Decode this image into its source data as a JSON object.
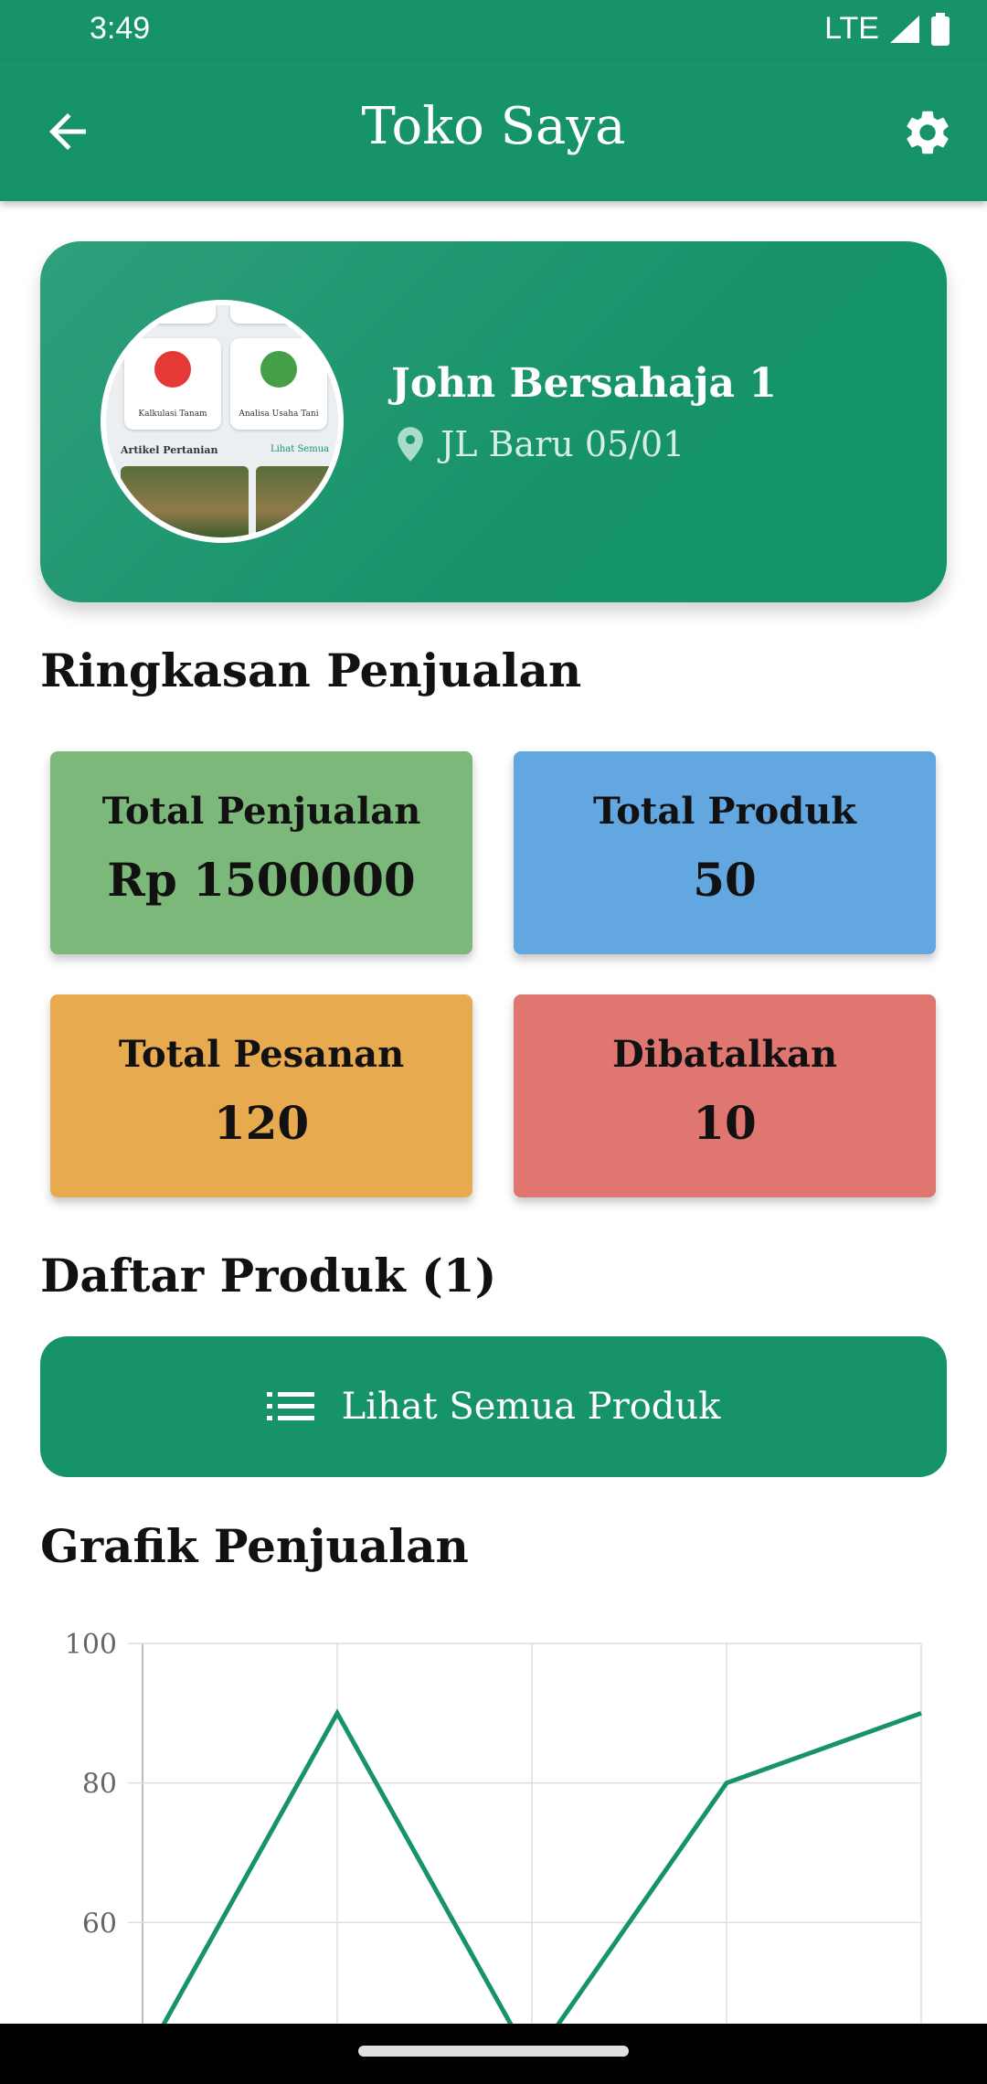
{
  "status_bar": {
    "time": "3:49",
    "network": "LTE"
  },
  "app_bar": {
    "title": "Toko Saya",
    "back_icon": "arrow-left-icon",
    "settings_icon": "gear-icon"
  },
  "profile": {
    "name": "John Bersahaja 1",
    "address": "JL Baru 05/01",
    "avatar_texts": {
      "tile1": "Kalkulasi Tanam",
      "tile2": "Analisa Usaha Tani",
      "section": "Artikel Pertanian",
      "link": "Lihat Semua"
    }
  },
  "summary": {
    "title": "Ringkasan Penjualan",
    "cards": [
      {
        "label": "Total Penjualan",
        "value": "Rp 1500000",
        "color": "#7db87b"
      },
      {
        "label": "Total Produk",
        "value": "50",
        "color": "#62a7e0"
      },
      {
        "label": "Total Pesanan",
        "value": "120",
        "color": "#e8aa4f"
      },
      {
        "label": "Dibatalkan",
        "value": "10",
        "color": "#e07670"
      }
    ]
  },
  "products": {
    "title": "Daftar Produk (1)",
    "view_all_label": "Lihat Semua Produk",
    "view_all_icon": "list-icon"
  },
  "chart_section": {
    "title": "Grafik Penjualan"
  },
  "chart_data": {
    "type": "line",
    "x": [
      0,
      1,
      2,
      3,
      4
    ],
    "series": [
      {
        "values": [
          40,
          90,
          40,
          80,
          90
        ],
        "color": "#16936b"
      }
    ],
    "yticks": [
      "100",
      "80",
      "60"
    ],
    "ylim": [
      40,
      100
    ],
    "grid": true
  }
}
